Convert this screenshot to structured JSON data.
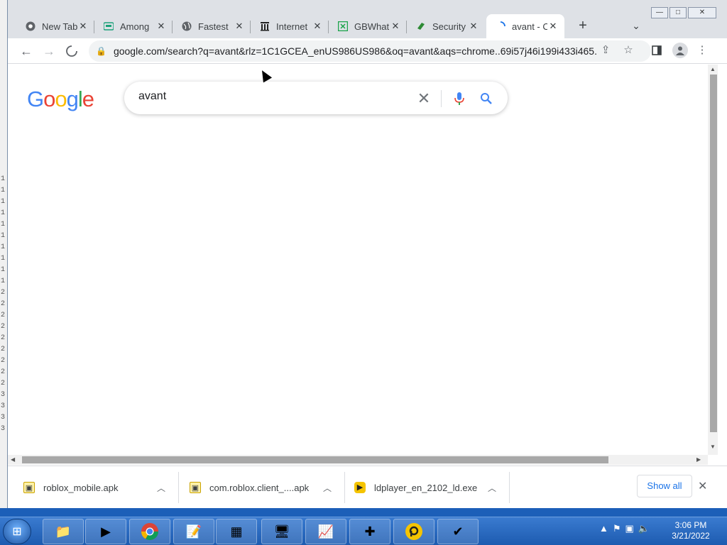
{
  "desktop": {
    "line_marks": [
      "1",
      "1",
      "1",
      "1",
      "1",
      "1",
      "1",
      "1",
      "1",
      "1",
      "2",
      "2",
      "2",
      "2",
      "2",
      "2",
      "2",
      "2",
      "2",
      "3",
      "3",
      "3",
      "3"
    ]
  },
  "tabs": [
    {
      "title": "New Tab",
      "icon": "chrome-icon"
    },
    {
      "title": "Among",
      "icon": "among-icon"
    },
    {
      "title": "Fastest",
      "icon": "globe-icon"
    },
    {
      "title": "Internet",
      "icon": "archive-icon"
    },
    {
      "title": "GBWhat",
      "icon": "gbwhatsapp-icon"
    },
    {
      "title": "Security",
      "icon": "security-icon"
    },
    {
      "title": "avant - C",
      "icon": "loading-icon",
      "active": true
    }
  ],
  "toolbar": {
    "url": "google.com/search?q=avant&rlz=1C1GCEA_enUS986US986&oq=avant&aqs=chrome..69i57j46i199i433i465..."
  },
  "google": {
    "logo_letters": [
      "G",
      "o",
      "o",
      "g",
      "l",
      "e"
    ],
    "logo_colors": [
      "#4285f4",
      "#ea4335",
      "#fbbc05",
      "#4285f4",
      "#34a853",
      "#ea4335"
    ],
    "query": "avant"
  },
  "downloads": [
    {
      "name": "roblox_mobile.apk"
    },
    {
      "name": "com.roblox.client_....apk"
    },
    {
      "name": "ldplayer_en_2102_ld.exe"
    }
  ],
  "shelf": {
    "show_all": "Show all"
  },
  "taskbar": {
    "time": "3:06 PM",
    "date": "3/21/2022"
  },
  "window_controls": {
    "min": "—",
    "max": "□",
    "close": "✕"
  }
}
